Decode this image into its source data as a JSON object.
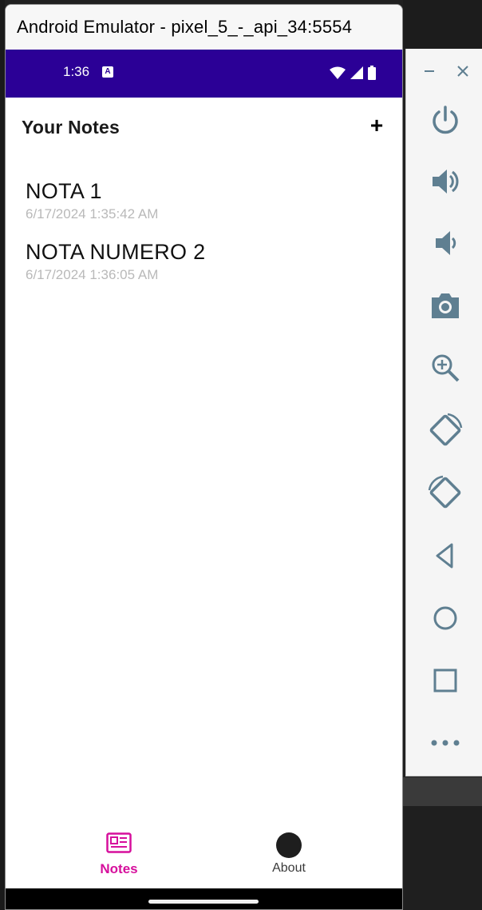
{
  "emulator": {
    "window_title": "Android Emulator - pixel_5_-_api_34:5554"
  },
  "status_bar": {
    "time": "1:36",
    "icons": [
      "notification-a-icon",
      "wifi-icon",
      "cellular-signal-icon",
      "battery-icon"
    ],
    "color": "#2b0096"
  },
  "app_bar": {
    "title": "Your Notes",
    "add_label": "+"
  },
  "notes": [
    {
      "title": "NOTA 1",
      "date": "6/17/2024 1:35:42 AM"
    },
    {
      "title": "NOTA NUMERO 2",
      "date": "6/17/2024 1:36:05 AM"
    }
  ],
  "tabs": [
    {
      "label": "Notes",
      "icon": "notes-icon",
      "selected": true,
      "color": "#d60f9c"
    },
    {
      "label": "About",
      "icon": "about-icon",
      "selected": false
    }
  ],
  "toolbar": {
    "controls": [
      "minimize-icon",
      "close-icon"
    ],
    "buttons": [
      "power-icon",
      "volume-up-icon",
      "volume-down-icon",
      "camera-icon",
      "zoom-icon",
      "rotate-left-icon",
      "rotate-right-icon",
      "back-icon",
      "home-icon",
      "overview-icon",
      "more-icon"
    ],
    "icon_color": "#5f7f91"
  }
}
